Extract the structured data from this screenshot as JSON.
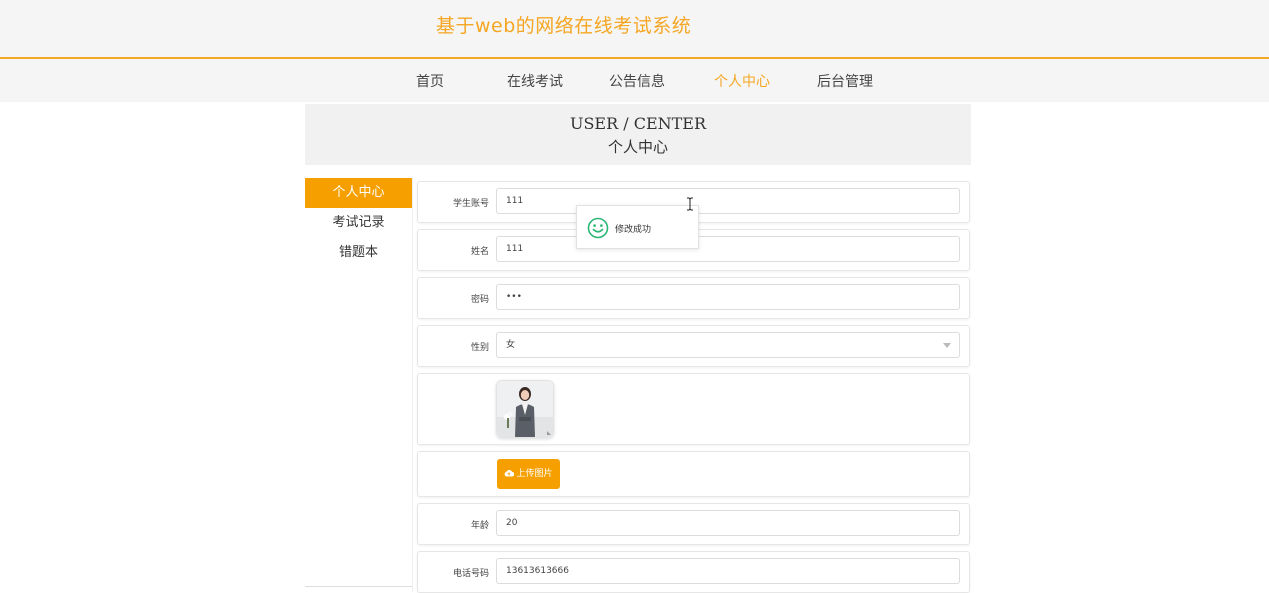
{
  "header": {
    "site_title": "基于web的网络在线考试系统"
  },
  "nav": {
    "items": [
      {
        "label": "首页"
      },
      {
        "label": "在线考试"
      },
      {
        "label": "公告信息"
      },
      {
        "label": "个人中心",
        "active": true
      },
      {
        "label": "后台管理"
      }
    ]
  },
  "banner": {
    "title_en": "USER / CENTER",
    "title_cn": "个人中心"
  },
  "sidebar": {
    "items": [
      {
        "label": "个人中心",
        "active": true
      },
      {
        "label": "考试记录"
      },
      {
        "label": "错题本"
      }
    ]
  },
  "form": {
    "account": {
      "label": "学生账号",
      "value": "111"
    },
    "name": {
      "label": "姓名",
      "value": "111"
    },
    "password": {
      "label": "密码",
      "value": "•••"
    },
    "gender": {
      "label": "性别",
      "value": "女"
    },
    "photo": {
      "icon": "avatar-photo"
    },
    "upload_button": "上传图片",
    "age": {
      "label": "年龄",
      "value": "20"
    },
    "phone": {
      "label": "电话号码",
      "value": "13613613666"
    }
  },
  "toast": {
    "message": "修改成功",
    "icon": "smile-icon"
  },
  "colors": {
    "accent": "#f5a623",
    "button": "#f5a000",
    "success": "#2bb673"
  }
}
